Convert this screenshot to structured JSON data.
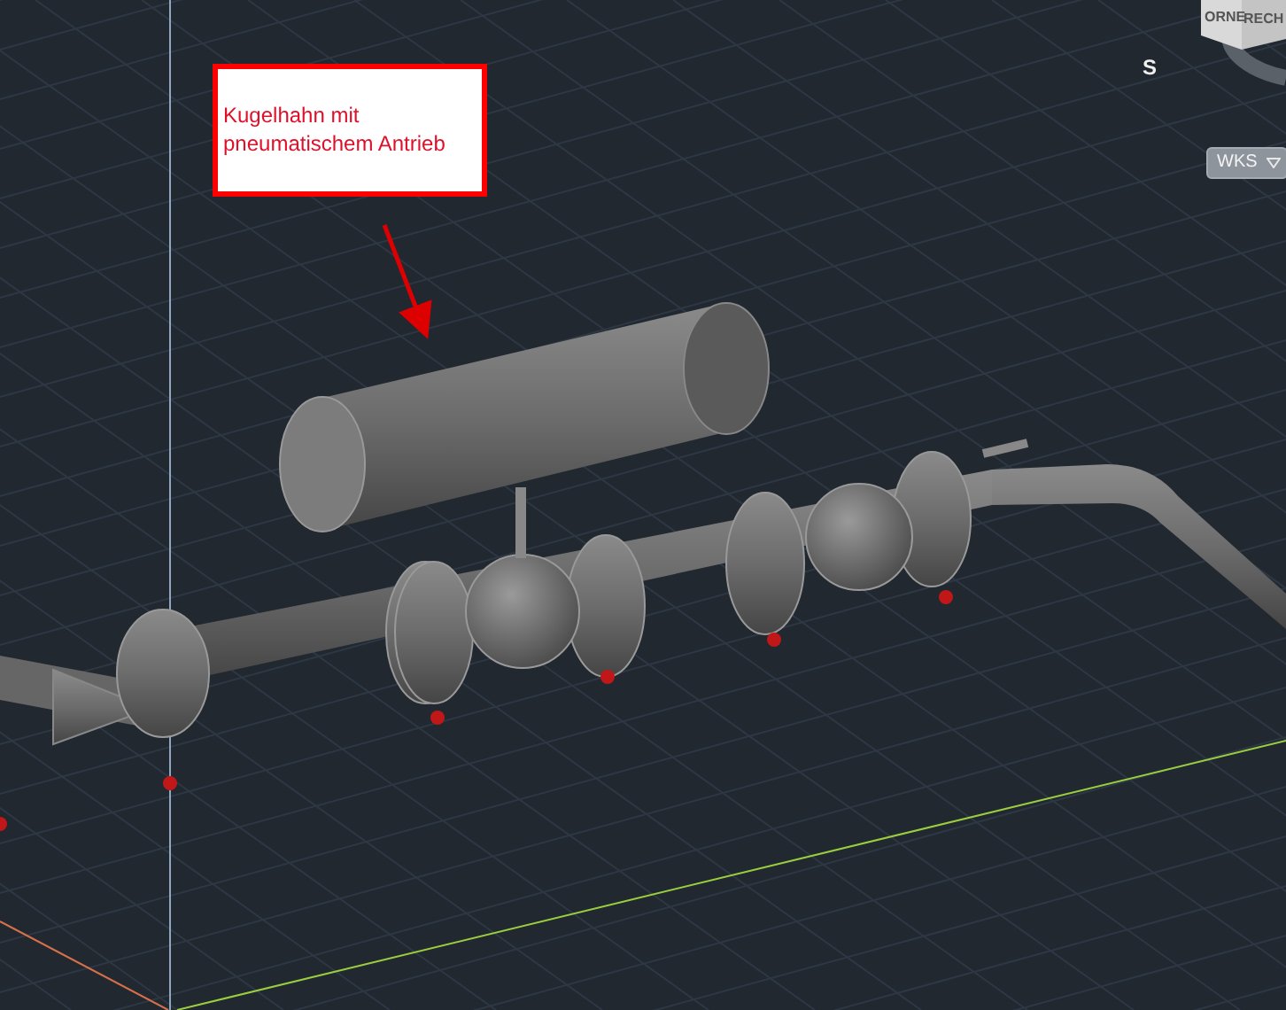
{
  "viewport": {
    "callout": {
      "text": "Kugelhahn mit pneumatischem Antrieb"
    }
  },
  "view_cube": {
    "faces": [
      "ORNE",
      "RECH"
    ],
    "compass": "S"
  },
  "ucs_menu": {
    "label": "WKS"
  }
}
